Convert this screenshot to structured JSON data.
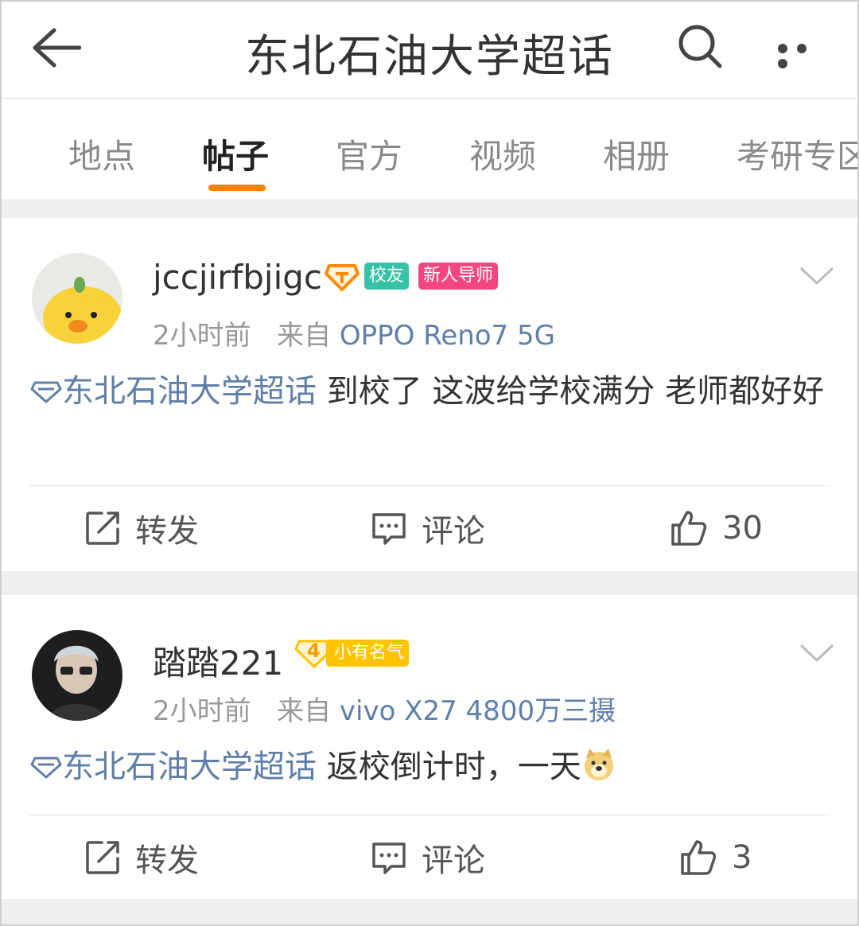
{
  "header": {
    "title": "东北石油大学超话",
    "back_icon": "arrow-left-icon",
    "search_icon": "search-icon",
    "more_icon": "more-dots-icon"
  },
  "tabs": [
    {
      "label": "地点",
      "active": false
    },
    {
      "label": "帖子",
      "active": true
    },
    {
      "label": "官方",
      "active": false
    },
    {
      "label": "视频",
      "active": false
    },
    {
      "label": "相册",
      "active": false
    },
    {
      "label": "考研专区",
      "active": false
    }
  ],
  "accent_color": "#ff8200",
  "link_color": "#5f7fa8",
  "posts": [
    {
      "username": "jccjirfbjigc",
      "badges": [
        "校友",
        "新人导师"
      ],
      "time": "2小时前",
      "source_prefix": "来自",
      "device": "OPPO Reno7 5G",
      "topic": "东北石油大学超话",
      "text": " 到校了 这波给学校满分 老师都好好",
      "repost_label": "转发",
      "comment_label": "评论",
      "likes": "30"
    },
    {
      "username": "踏踏221",
      "level": "4",
      "badges": [
        "小有名气"
      ],
      "time": "2小时前",
      "source_prefix": "来自",
      "device": "vivo X27 4800万三摄",
      "topic": "东北石油大学超话",
      "text": " 返校倒计时，一天",
      "emoji": "doge-emoji",
      "repost_label": "转发",
      "comment_label": "评论",
      "likes": "3"
    }
  ]
}
